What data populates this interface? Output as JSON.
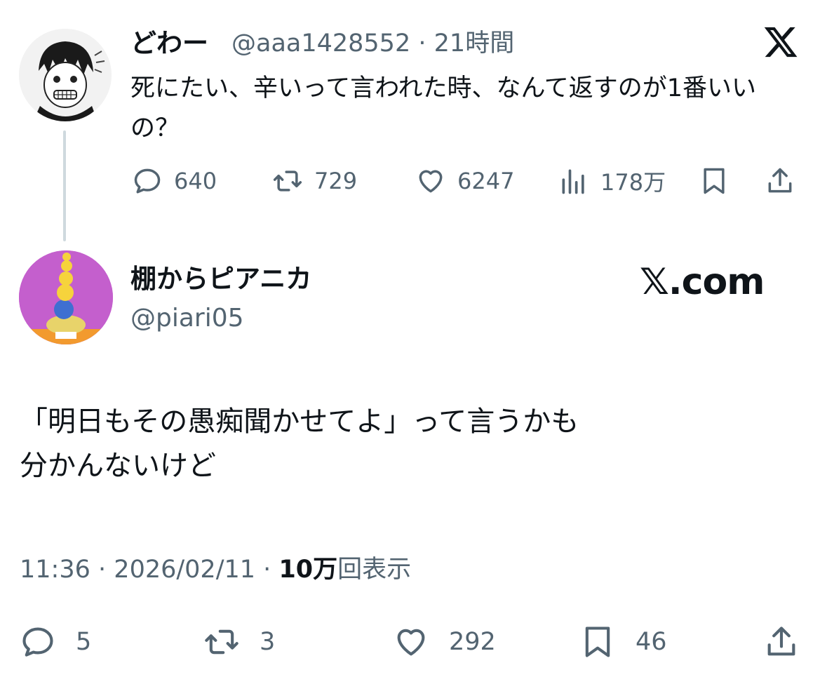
{
  "quoted_tweet": {
    "display_name": "どわー",
    "handle": "@aaa1428552",
    "separator": "·",
    "time_ago": "21時間",
    "text": "死にたい、辛いって言われた時、なんて返すのが1番いいの？",
    "actions": {
      "reply_count": "640",
      "retweet_count": "729",
      "like_count": "6247",
      "views_count": "178万"
    }
  },
  "reply_tweet": {
    "display_name": "棚からピアニカ",
    "handle": "@piari05",
    "watermark": "𝕏.com",
    "text_line1": "「明日もその愚痴聞かせてよ」って言うかも",
    "text_line2": "分かんないけど",
    "time": "11:36",
    "date": "2026/02/11",
    "separator": "·",
    "views_number": "10万",
    "views_label": "回表示",
    "actions": {
      "reply_count": "5",
      "retweet_count": "3",
      "like_count": "292",
      "bookmark_count": "46"
    }
  },
  "icons": [
    "reply-icon",
    "retweet-icon",
    "like-icon",
    "views-icon",
    "bookmark-icon",
    "share-icon",
    "x-logo-icon"
  ],
  "colors": {
    "text": "#0f1419",
    "muted": "#536471",
    "thread_line": "#cfd9de",
    "avatar2_bg": "#c45fcd"
  }
}
